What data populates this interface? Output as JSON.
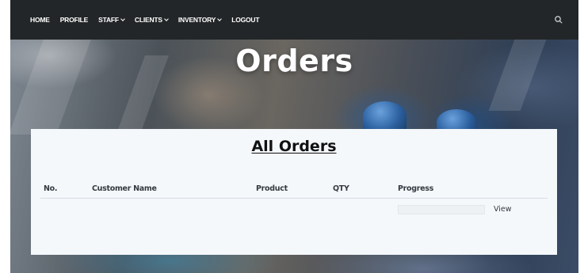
{
  "navbar": {
    "items": [
      {
        "label": "HOME",
        "has_dropdown": false
      },
      {
        "label": "PROFILE",
        "has_dropdown": false
      },
      {
        "label": "STAFF",
        "has_dropdown": true
      },
      {
        "label": "CLIENTS",
        "has_dropdown": true
      },
      {
        "label": "INVENTORY",
        "has_dropdown": true
      },
      {
        "label": "LOGOUT",
        "has_dropdown": false
      }
    ],
    "search_icon": "search-icon"
  },
  "hero": {
    "title": "Orders"
  },
  "orders": {
    "title": "All Orders",
    "columns": [
      "No.",
      "Customer Name",
      "Product",
      "QTY",
      "Progress"
    ],
    "rows": [
      {
        "no": "",
        "customer_name": "",
        "product": "",
        "qty": "",
        "progress": 0,
        "action": "View"
      }
    ]
  },
  "colors": {
    "navbar_bg": "#232628",
    "panel_bg": "#f4f8fb",
    "nav_text": "#ffffff"
  }
}
